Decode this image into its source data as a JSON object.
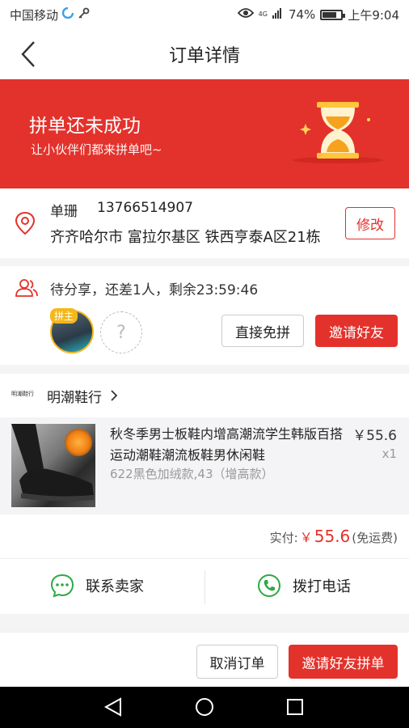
{
  "status_bar": {
    "carrier": "中国移动",
    "network": "4G",
    "battery": "74%",
    "battery_level": 0.74,
    "time": "上午9:04"
  },
  "nav": {
    "title": "订单详情"
  },
  "banner": {
    "title": "拼单还未成功",
    "subtitle": "让小伙伴们都来拼单吧~"
  },
  "address": {
    "name": "单珊",
    "phone": "13766514907",
    "address": "齐齐哈尔市 富拉尔基区 铁西亨泰A区21栋",
    "edit_label": "修改"
  },
  "group": {
    "status": "待分享，还差1人，剩余23:59:46",
    "leader_tag": "拼主",
    "empty_slot": "?",
    "direct_label": "直接免拼",
    "invite_label": "邀请好友"
  },
  "shop": {
    "logo_text": "明潮鞋行",
    "name": "明潮鞋行"
  },
  "product": {
    "title": "秋冬季男士板鞋内增高潮流学生韩版百搭运动潮鞋潮流板鞋男休闲鞋",
    "price": "￥55.6",
    "qty": "x1",
    "sku": "622黑色加绒款,43（增高款）"
  },
  "payment": {
    "label": "实付:",
    "currency": "￥",
    "amount": "55.6",
    "note": "(免运费)"
  },
  "contact": {
    "seller_label": "联系卖家",
    "call_label": "拨打电话"
  },
  "actions": {
    "cancel_label": "取消订单",
    "invite_label": "邀请好友拼单"
  },
  "colors": {
    "accent": "#e3322c",
    "green": "#2ea945",
    "gold": "#f3b81c"
  }
}
